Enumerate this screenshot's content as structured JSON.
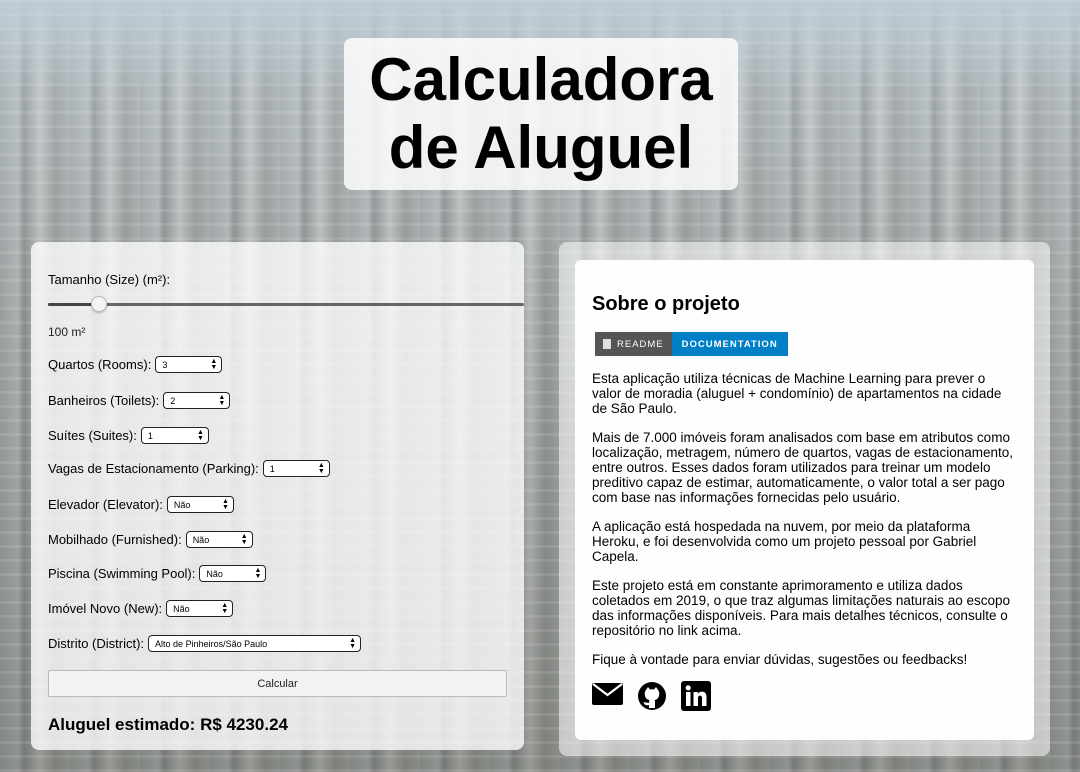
{
  "title": {
    "line1": "Calculadora",
    "line2": "de Aluguel"
  },
  "form": {
    "size_label": "Tamanho (Size) (m²):",
    "size_value": 100,
    "size_min": 30,
    "size_max": 3000,
    "size_display": "100 m²",
    "fields": [
      {
        "label": "Quartos (Rooms):",
        "value": "3"
      },
      {
        "label": "Banheiros (Toilets):",
        "value": "2"
      },
      {
        "label": "Suítes (Suites):",
        "value": "1"
      },
      {
        "label": "Vagas de Estacionamento (Parking):",
        "value": "1"
      },
      {
        "label": "Elevador (Elevator):",
        "value": "Não"
      },
      {
        "label": "Mobilhado (Furnished):",
        "value": "Não"
      },
      {
        "label": "Piscina (Swimming Pool):",
        "value": "Não"
      },
      {
        "label": "Imóvel Novo (New):",
        "value": "Não"
      },
      {
        "label": "Distrito (District):",
        "value": "Alto de Pinheiros/São Paulo"
      }
    ],
    "button_label": "Calcular",
    "result": "Aluguel estimado: R$ 4230.24"
  },
  "about": {
    "heading": "Sobre o projeto",
    "badge_left": "README",
    "badge_right": "DOCUMENTATION",
    "badge_colors": {
      "left": "#555555",
      "right": "#007ec6"
    },
    "paragraphs": [
      "Esta aplicação utiliza técnicas de Machine Learning para prever o valor de moradia (aluguel + condomínio) de apartamentos na cidade de São Paulo.",
      "Mais de 7.000 imóveis foram analisados com base em atributos como localização, metragem, número de quartos, vagas de estacionamento, entre outros. Esses dados foram utilizados para treinar um modelo preditivo capaz de estimar, automaticamente, o valor total a ser pago com base nas informações fornecidas pelo usuário.",
      "A aplicação está hospedada na nuvem, por meio da plataforma Heroku, e foi desenvolvida como um projeto pessoal por Gabriel Capela.",
      "Este projeto está em constante aprimoramento e utiliza dados coletados em 2019, o que traz algumas limitações naturais ao escopo das informações disponíveis. Para mais detalhes técnicos, consulte o repositório no link acima.",
      "Fique à vontade para enviar dúvidas, sugestões ou feedbacks!"
    ],
    "contact_icons": [
      "email-icon",
      "github-icon",
      "linkedin-icon"
    ]
  }
}
